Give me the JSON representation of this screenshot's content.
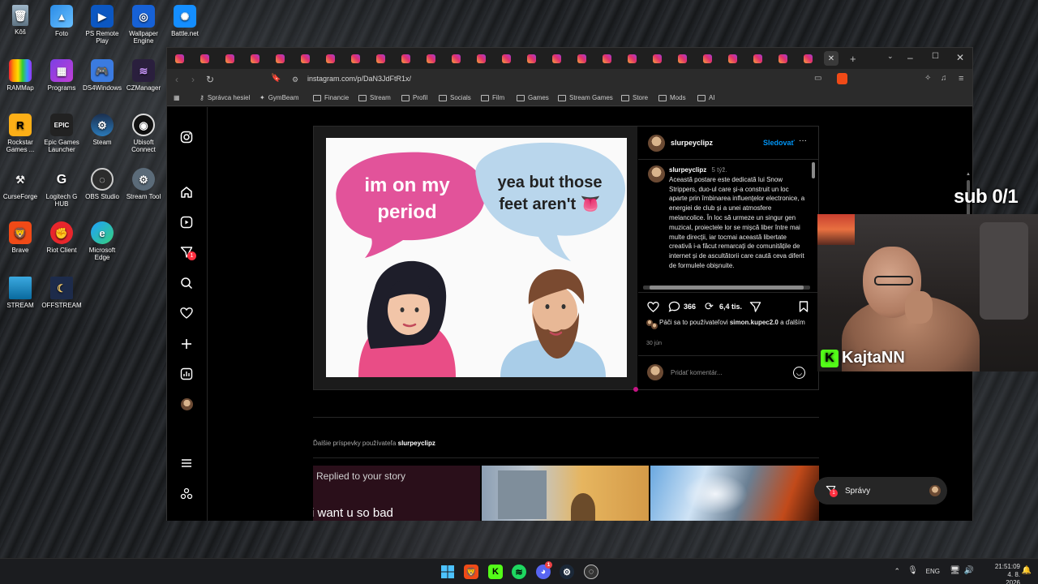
{
  "desktop": {
    "icons": [
      {
        "label": "Kôš"
      },
      {
        "label": "Foto"
      },
      {
        "label": "PS Remote Play"
      },
      {
        "label": "Wallpaper Engine"
      },
      {
        "label": "Battle.net"
      },
      {
        "label": "RAMMap"
      },
      {
        "label": "Programs"
      },
      {
        "label": "DS4Windows"
      },
      {
        "label": "CZManager"
      },
      {
        "label": "Rockstar Games ..."
      },
      {
        "label": "Epic Games Launcher"
      },
      {
        "label": "Steam"
      },
      {
        "label": "Ubisoft Connect"
      },
      {
        "label": "CurseForge"
      },
      {
        "label": "Logitech G HUB"
      },
      {
        "label": "OBS Studio"
      },
      {
        "label": "Stream Tool"
      },
      {
        "label": "Brave"
      },
      {
        "label": "Riot Client"
      },
      {
        "label": "Microsoft Edge"
      },
      {
        "label": "STREAM"
      },
      {
        "label": "OFFSTREAM"
      }
    ]
  },
  "browser": {
    "url": "instagram.com/p/DaN3JdFtR1x/",
    "bookmarks": [
      {
        "label": "Správca hesiel"
      },
      {
        "label": "GymBeam"
      },
      {
        "label": "Financie"
      },
      {
        "label": "Stream"
      },
      {
        "label": "Profil"
      },
      {
        "label": "Socials"
      },
      {
        "label": "Film"
      },
      {
        "label": "Games"
      },
      {
        "label": "Stream Games"
      },
      {
        "label": "Store"
      },
      {
        "label": "Mods"
      },
      {
        "label": "AI"
      }
    ]
  },
  "post": {
    "meme": {
      "left_bubble": "im on my period",
      "right_bubble": "yea but those feet aren't 👅"
    },
    "username": "slurpeyclipz",
    "follow_label": "Sledovať",
    "more_label": "···",
    "caption_user": "slurpeyclipz",
    "caption_age": "5 týž.",
    "caption_text": "Această postare este dedicată lui Snow Strippers, duo-ul care și-a construit un loc aparte prin îmbinarea influențelor electronice, a energiei de club și a unei atmosfere melancolice. În loc să urmeze un singur gen muzical, proiectele lor se mișcă liber între mai multe direcții, iar tocmai această libertate creativă i-a făcut remarcați de comunitățile de internet și de ascultătorii care caută ceva diferit de formulele obișnuite.",
    "comments_count": "366",
    "reposts_count": "6,4 tis.",
    "likes_prefix": "Páči sa to používateľovi",
    "likes_user": "simon.kupec2.0",
    "likes_suffix": "a ďalším",
    "date": "30 jún",
    "comment_placeholder": "Pridať komentár..."
  },
  "more_posts": {
    "prefix": "Ďalšie príspevky používateľa",
    "user": "slurpeyclipz",
    "thumb1_line1": "Replied to your story",
    "thumb1_line2": "i want u so bad"
  },
  "messages": {
    "label": "Správy",
    "badge": "1"
  },
  "notifications_badge": "1",
  "overlay": {
    "sub_counter": "sub 0/1",
    "streamer": "KajtaNN",
    "kick_glyph": "K"
  },
  "taskbar": {
    "lang": "ENG",
    "time": "21:51:09",
    "date": "4. 8. 2026",
    "discord_badge": "1"
  },
  "colors": {
    "instagram_bg": "#000000",
    "follow_blue": "#0095f6",
    "bubble_pink": "#e2539a",
    "bubble_blue": "#b9d6ec",
    "kick_green": "#53fc18",
    "notif_red": "#ff3040"
  }
}
